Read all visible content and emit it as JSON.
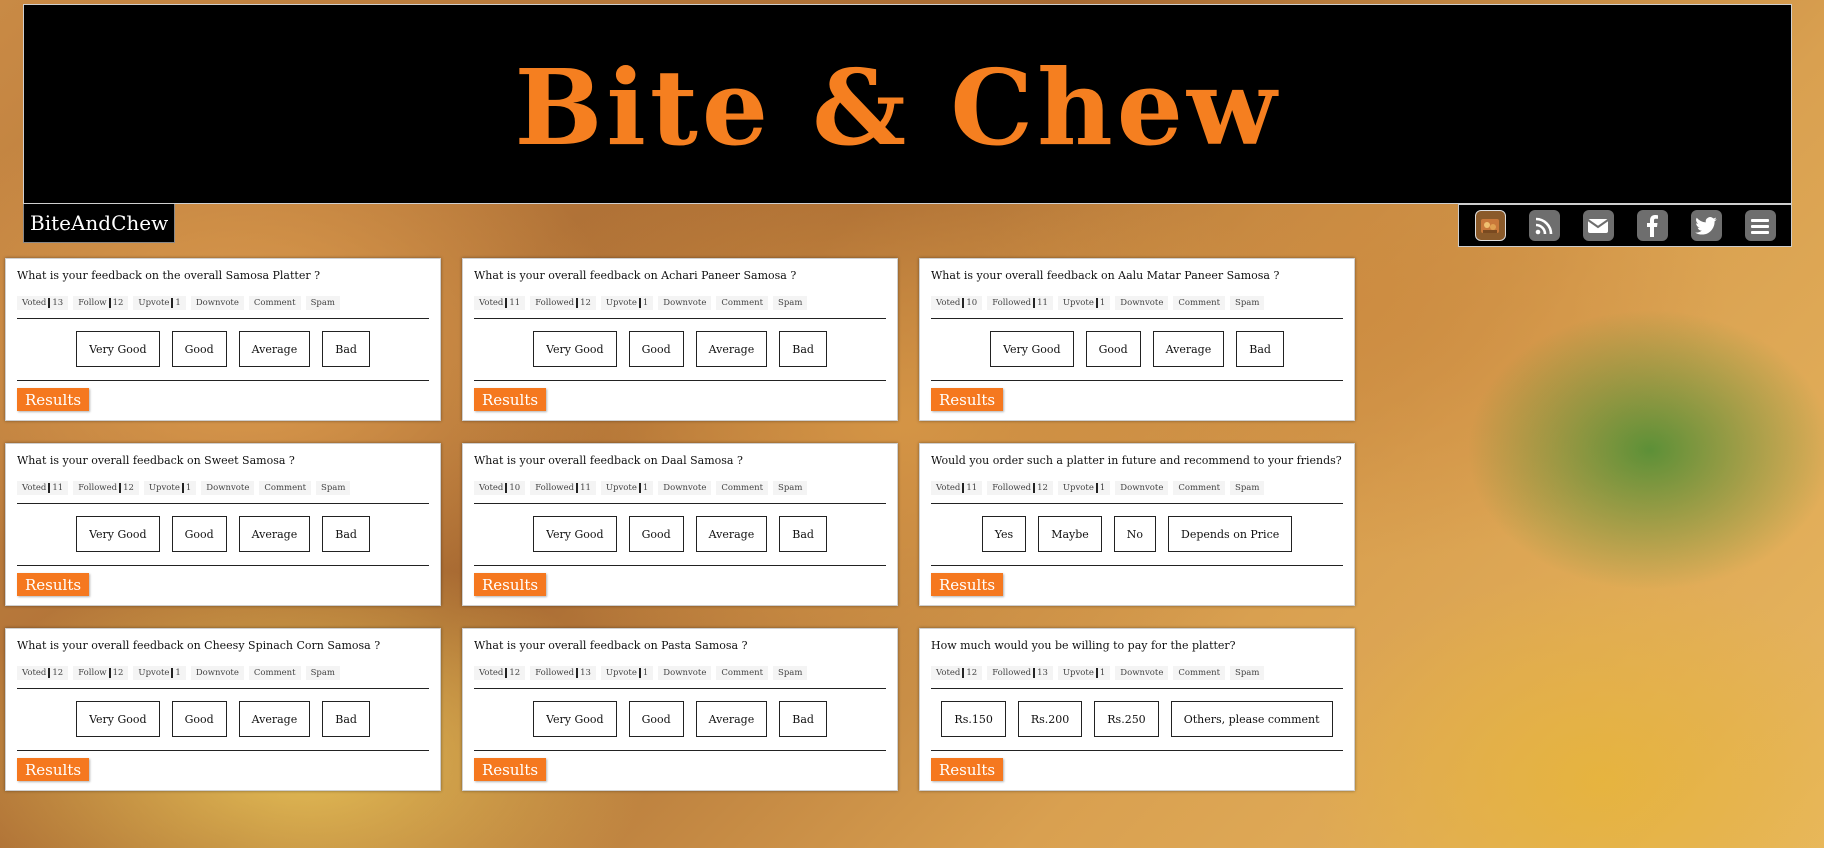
{
  "header": {
    "title": "Bite & Chew",
    "brand": "BiteAndChew"
  },
  "toolbar": {
    "icons": [
      "profile-avatar-icon",
      "rss-icon",
      "email-icon",
      "facebook-icon",
      "twitter-icon",
      "menu-icon"
    ]
  },
  "labels": {
    "results": "Results",
    "downvote": "Downvote",
    "comment": "Comment",
    "spam": "Spam",
    "upvote": "Upvote"
  },
  "cards": [
    {
      "question": "What is your feedback on the overall Samosa Platter ?",
      "voted": "13",
      "follow_label": "Follow",
      "follow": "12",
      "upvote": "1",
      "options": [
        "Very Good",
        "Good",
        "Average",
        "Bad"
      ]
    },
    {
      "question": "What is your overall feedback on Achari Paneer Samosa ?",
      "voted": "11",
      "follow_label": "Followed",
      "follow": "12",
      "upvote": "1",
      "options": [
        "Very Good",
        "Good",
        "Average",
        "Bad"
      ]
    },
    {
      "question": "What is your overall feedback on Aalu Matar Paneer Samosa ?",
      "voted": "10",
      "follow_label": "Followed",
      "follow": "11",
      "upvote": "1",
      "options": [
        "Very Good",
        "Good",
        "Average",
        "Bad"
      ]
    },
    {
      "question": "What is your overall feedback on Sweet Samosa ?",
      "voted": "11",
      "follow_label": "Followed",
      "follow": "12",
      "upvote": "1",
      "options": [
        "Very Good",
        "Good",
        "Average",
        "Bad"
      ]
    },
    {
      "question": "What is your overall feedback on Daal Samosa ?",
      "voted": "10",
      "follow_label": "Followed",
      "follow": "11",
      "upvote": "1",
      "options": [
        "Very Good",
        "Good",
        "Average",
        "Bad"
      ]
    },
    {
      "question": "Would you order such a platter in future and recommend to your friends?",
      "voted": "11",
      "follow_label": "Followed",
      "follow": "12",
      "upvote": "1",
      "options": [
        "Yes",
        "Maybe",
        "No",
        "Depends on Price"
      ]
    },
    {
      "question": "What is your overall feedback on Cheesy Spinach Corn Samosa ?",
      "voted": "12",
      "follow_label": "Follow",
      "follow": "12",
      "upvote": "1",
      "options": [
        "Very Good",
        "Good",
        "Average",
        "Bad"
      ]
    },
    {
      "question": "What is your overall feedback on Pasta Samosa ?",
      "voted": "12",
      "follow_label": "Followed",
      "follow": "13",
      "upvote": "1",
      "options": [
        "Very Good",
        "Good",
        "Average",
        "Bad"
      ]
    },
    {
      "question": "How much would you be willing to pay for the platter?",
      "voted": "12",
      "follow_label": "Followed",
      "follow": "13",
      "upvote": "1",
      "options": [
        "Rs.150",
        "Rs.200",
        "Rs.250",
        "Others, please comment"
      ]
    }
  ],
  "colors": {
    "accent": "#f5781f",
    "banner_bg": "#000000"
  }
}
